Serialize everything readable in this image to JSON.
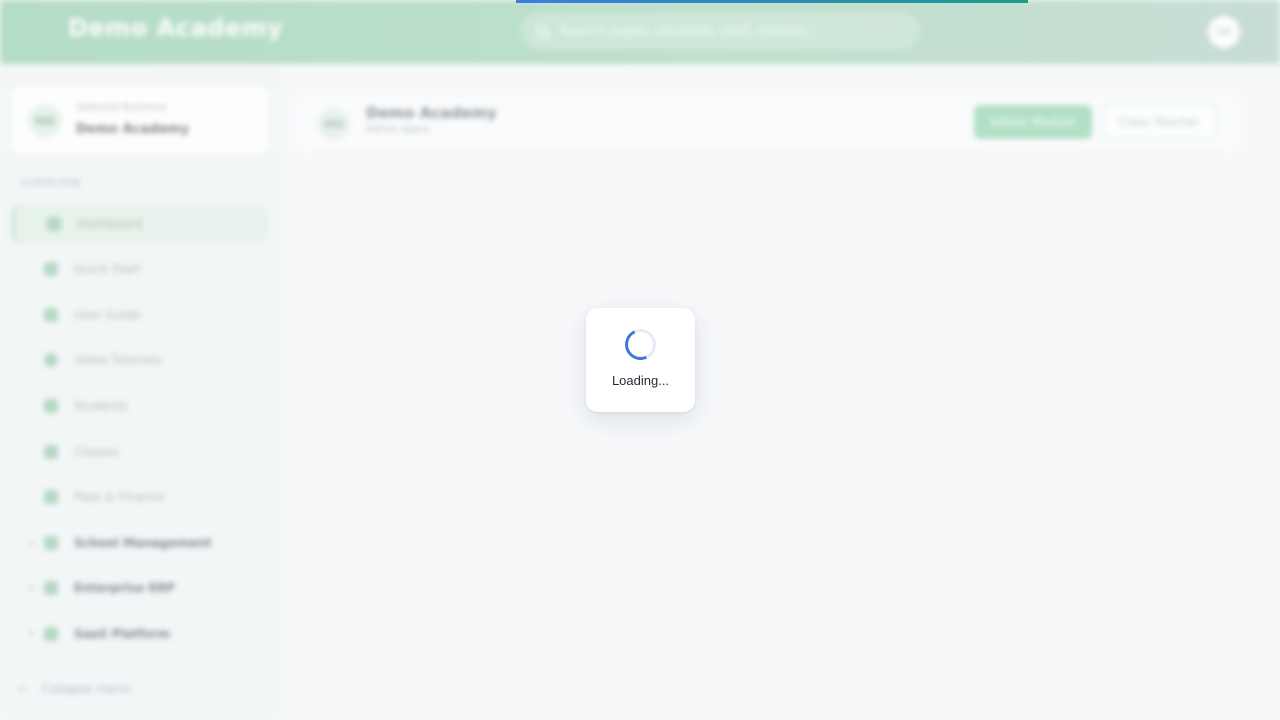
{
  "topbar": {
    "brand": "Demo Academy",
    "search_placeholder": "Search pages, students, staff, classes...",
    "avatar_initials": "DA"
  },
  "sidebar": {
    "school_label": "Selected Business",
    "school_name": "Demo Academy",
    "school_logo": "MD",
    "section_heading": "OVERVIEW",
    "items": [
      {
        "label": "Dashboard",
        "icon": "home-icon",
        "active": true
      },
      {
        "label": "Quick Start",
        "icon": "rocket-icon"
      },
      {
        "label": "User Guide",
        "icon": "book-icon"
      },
      {
        "label": "Video Tutorials",
        "icon": "play-icon"
      },
      {
        "label": "Students",
        "icon": "student-icon"
      },
      {
        "label": "Classes",
        "icon": "monitor-icon"
      },
      {
        "label": "Fees & Finance",
        "icon": "wallet-icon"
      },
      {
        "label": "School Management",
        "icon": "building-icon",
        "expandable": true
      },
      {
        "label": "Enterprise ERP",
        "icon": "building-icon",
        "expandable": true
      },
      {
        "label": "SaaS Platform",
        "icon": "cloud-icon",
        "expandable": true
      }
    ],
    "collapse_label": "Collapse menu"
  },
  "header": {
    "logo": "MD",
    "title": "Demo Academy",
    "subtitle": "Admin space",
    "primary_button": "Admin Module",
    "secondary_button": "Class Teacher"
  },
  "progress": {
    "start_fraction": 0.403,
    "fill_fraction": 0.4
  },
  "loader": {
    "text": "Loading..."
  },
  "colors": {
    "accent": "#3b78d8",
    "brand": "#a9d8bd"
  }
}
